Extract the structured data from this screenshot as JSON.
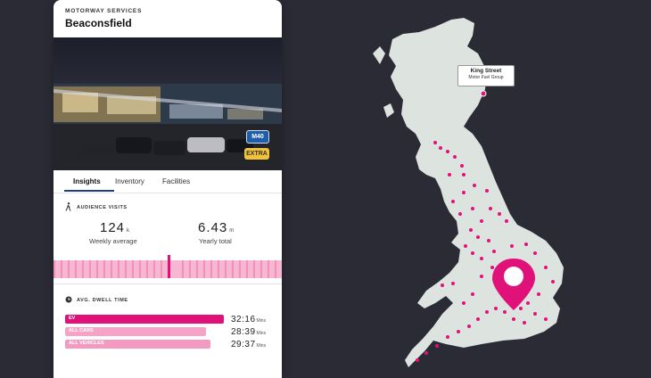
{
  "panel": {
    "category": "MOTORWAY SERVICES",
    "title": "Beaconsfield",
    "badges": {
      "motorway": "M40",
      "tier": "EXTRA"
    },
    "tabs": [
      "Insights",
      "Inventory",
      "Facilities"
    ],
    "audience": {
      "heading": "AUDIENCE VISITS",
      "weekly_value": "124",
      "weekly_unit": "k",
      "weekly_label": "Weekly average",
      "yearly_value": "6.43",
      "yearly_unit": "m",
      "yearly_label": "Yearly total"
    },
    "dwell": {
      "heading": "AVG. DWELL TIME",
      "rows": [
        {
          "label": "EV",
          "time": "32:16",
          "unit": "Mins",
          "color": "#e0127a",
          "fill": 1.0
        },
        {
          "label": "ALL CARS",
          "time": "28:39",
          "unit": "Mins",
          "color": "#f7a3c8",
          "fill": 0.888
        },
        {
          "label": "ALL VEHICLES",
          "time": "29:37",
          "unit": "Mins",
          "color": "#f29ac2",
          "fill": 0.918
        }
      ]
    }
  },
  "map": {
    "tooltip_name": "King Street",
    "tooltip_sub": "Motor Fuel Group",
    "land_color": "#dde4e0",
    "marker_color": "#e0127a"
  },
  "colors": {
    "background": "#2b2b36",
    "accent": "#e0127a",
    "tab_underline": "#1d3f8f"
  }
}
